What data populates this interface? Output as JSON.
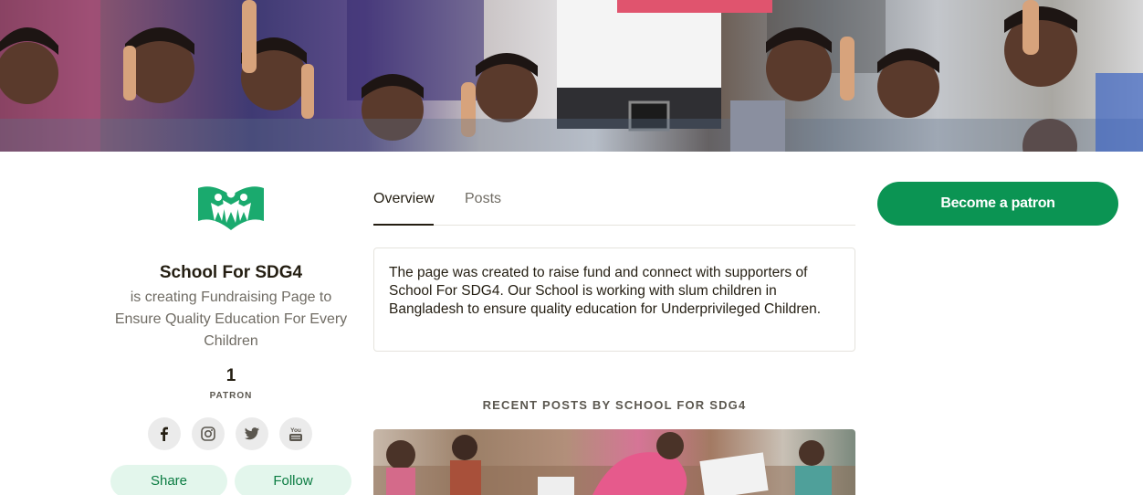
{
  "creator": {
    "name": "School For SDG4",
    "description": "is creating Fundraising Page to Ensure Quality Education For Every Children",
    "patron_count": "1",
    "patron_label": "PATRON"
  },
  "social_links": [
    {
      "icon": "facebook-icon"
    },
    {
      "icon": "instagram-icon"
    },
    {
      "icon": "twitter-icon"
    },
    {
      "icon": "youtube-icon",
      "text": "You"
    }
  ],
  "actions": {
    "share_label": "Share",
    "follow_label": "Follow",
    "become_patron_label": "Become a patron"
  },
  "tabs": [
    {
      "label": "Overview",
      "active": true
    },
    {
      "label": "Posts",
      "active": false
    }
  ],
  "about_text": "The page was created to raise fund and connect with supporters of School For SDG4. Our School is working with slum children in Bangladesh to ensure quality education for Underprivileged Children.",
  "recent_posts_heading": "RECENT POSTS BY SCHOOL FOR SDG4",
  "colors": {
    "brand_green": "#0b9453",
    "light_green_bg": "#e3f6ec",
    "light_green_text": "#0b7c42",
    "logo_green": "#1aaa6e"
  }
}
